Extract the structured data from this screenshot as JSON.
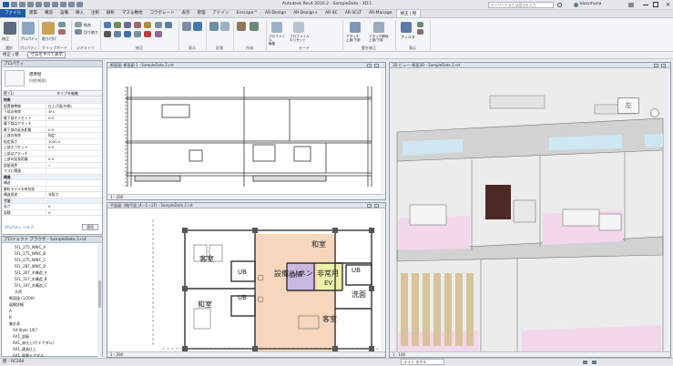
{
  "app_title": "Autodesk Revit 2016.2 - SampleData - 3D:1",
  "search_placeholder": "キーワードまたは語句を入力",
  "user": "kazumuna",
  "tabs": [
    "ファイル",
    "建築",
    "構造",
    "設備",
    "挿入",
    "注釈",
    "解析",
    "マス＆敷地",
    "コラボレート",
    "表示",
    "管理",
    "アドイン",
    "Enscape™",
    "AR-Design",
    "AR-Design+",
    "AR-SC",
    "AR-SCLT",
    "AR-Manage",
    "修正 | 壁"
  ],
  "ribbon_groups": [
    "選択",
    "プロパティ",
    "クリップボード",
    "ジオメトリ",
    "修正",
    "表示",
    "計測",
    "作成",
    "モード",
    "壁を修正",
    "表示"
  ],
  "ribbon_labels": {
    "modify": "修正",
    "properties": "プロパティ",
    "paste": "貼り付け",
    "join": "結合",
    "cut": "切り取り",
    "profile_edit": "プロファイル\n編集",
    "profile_reset": "プロファイル\nのリセット",
    "attach": "アタッチ\n上部/下部",
    "detach": "アタッチ解除\n上部/下部",
    "filter": "フィルタ"
  },
  "options_bar": {
    "label": "修正 | 壁",
    "button": "寸法をすべて表示"
  },
  "properties": {
    "title": "プロパティ",
    "type_name": "標準壁",
    "type_sub": "内壁(軽鉄)",
    "type_selector": "壁 (1)",
    "edit_type": "タイプを編集",
    "rows": [
      {
        "k": "拘束",
        "v": "",
        "sec": true
      },
      {
        "k": "配置基準線",
        "v": "仕上げ面(外側)"
      },
      {
        "k": "下部の拘束",
        "v": "4FL"
      },
      {
        "k": "最下部オフセット",
        "v": "0.0"
      },
      {
        "k": "最下部はアタッチ",
        "v": ""
      },
      {
        "k": "最下部の延長距離",
        "v": "0.0"
      },
      {
        "k": "上部の拘束",
        "v": "指定"
      },
      {
        "k": "指定高さ",
        "v": "3050.0"
      },
      {
        "k": "上部オフセット",
        "v": "0.0"
      },
      {
        "k": "上部はアタッチ",
        "v": ""
      },
      {
        "k": "上部の延長距離",
        "v": "0.0"
      },
      {
        "k": "部屋境界",
        "v": "✓"
      },
      {
        "k": "マスに関連",
        "v": ""
      },
      {
        "k": "構造",
        "v": "",
        "sec": true
      },
      {
        "k": "構造",
        "v": ""
      },
      {
        "k": "解析モデルを有効化",
        "v": ""
      },
      {
        "k": "構造用途",
        "v": "非耐力"
      },
      {
        "k": "寸法",
        "v": "",
        "sec": true
      },
      {
        "k": "長さ",
        "v": "0"
      },
      {
        "k": "面積",
        "v": "0"
      }
    ],
    "help": "プロパティ ヘルプ",
    "apply": "適用"
  },
  "browser": {
    "title": "プロジェクト ブラウザ - SampleData 2.rvt",
    "items": [
      "5FL_275_WWC_A",
      "5FL_275_WWC_B",
      "5FL_275_WWC_C",
      "5FL_287_WWC_D",
      "5FL_307_木構造_A",
      "5FL_317_木構造_B",
      "5FL_347_木構造_C",
      "凡例",
      "断面図 (1/200)",
      "展開詳細",
      "A",
      "B",
      "集計表",
      "AX-Style 1/67",
      "AX1_部屋",
      "AX1_床仕上げ(テアダル)",
      "AX1_建具仕上",
      "AX1_展開テアダル",
      "AX2_建具テアダル"
    ]
  },
  "views": {
    "section_title": "断面図: 断面図 1 - SampleData 2.rvt",
    "plan_title": "平面図: 4階平面 (4ー1ー2F) - SampleData 2.rvt",
    "view3d_title": "3D ビュー: 断面3D - SampleData 2.rvt",
    "scale_left": "1 : 200",
    "scale_right": "1 : 100",
    "viewcube": "左"
  },
  "plan_rooms": [
    "和室",
    "客室",
    "UB",
    "UB",
    "倉庫",
    "EV",
    "設備/リネン",
    "非常用",
    "和室",
    "UB",
    "洗面",
    "客室"
  ],
  "statusbar": {
    "left": "壁 : RC200",
    "model": "メイン モデル"
  }
}
